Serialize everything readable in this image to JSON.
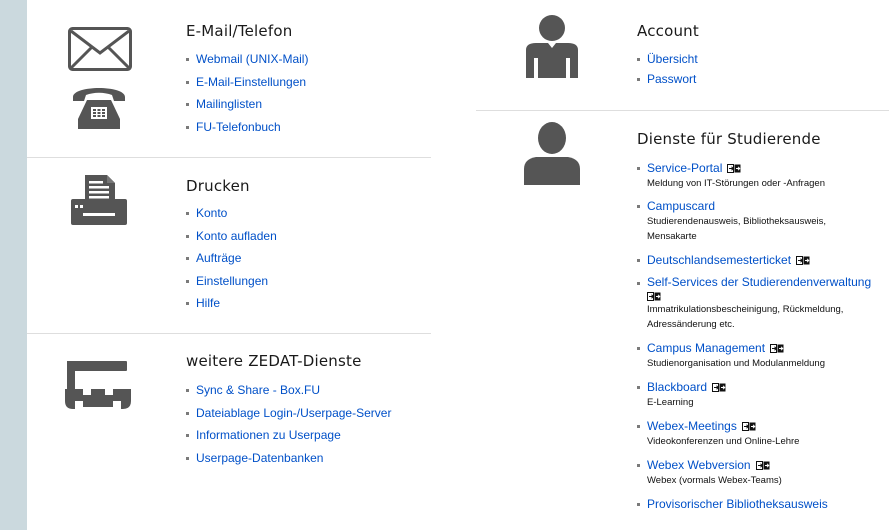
{
  "sections": {
    "email": {
      "title": "E-Mail/Telefon",
      "links": [
        "Webmail (UNIX-Mail)",
        "E-Mail-Einstellungen",
        "Mailinglisten",
        "FU-Telefonbuch"
      ],
      "icons": [
        "envelope-icon",
        "telephone-icon"
      ]
    },
    "print": {
      "title": "Drucken",
      "links": [
        "Konto",
        "Konto aufladen",
        "Aufträge",
        "Einstellungen",
        "Hilfe"
      ],
      "icons": [
        "printer-icon"
      ]
    },
    "more": {
      "title": "weitere ZEDAT-Dienste",
      "links": [
        "Sync & Share - Box.FU",
        "Dateiablage Login-/Userpage-Server",
        "Informationen zu Userpage",
        "Userpage-Datenbanken"
      ],
      "icons": [
        "tools-icon"
      ]
    },
    "account": {
      "title": "Account",
      "links": [
        "Übersicht",
        "Passwort"
      ],
      "icons": [
        "user-suit-icon"
      ]
    },
    "students": {
      "title": "Dienste für Studierende",
      "icons": [
        "student-icon"
      ],
      "items": [
        {
          "label": "Service-Portal",
          "external": true,
          "desc": [
            "Meldung von IT-Störungen oder -Anfragen"
          ]
        },
        {
          "label": "Campuscard",
          "external": false,
          "desc": [
            "Studierendenausweis, Bibliotheksausweis,",
            "Mensakarte"
          ]
        },
        {
          "label": "Deutschlandsemesterticket",
          "external": true,
          "desc": []
        },
        {
          "label": "Self-Services der Studierendenverwaltung",
          "external": true,
          "desc": [
            "Immatrikulationsbescheinigung, Rückmeldung,",
            "Adressänderung etc."
          ]
        },
        {
          "label": "Campus Management",
          "external": true,
          "desc": [
            "Studienorganisation und Modulanmeldung"
          ]
        },
        {
          "label": "Blackboard",
          "external": true,
          "desc": [
            "E-Learning"
          ]
        },
        {
          "label": "Webex-Meetings",
          "external": true,
          "desc": [
            "Videokonferenzen und Online-Lehre"
          ]
        },
        {
          "label": "Webex Webversion",
          "external": true,
          "desc": [
            "Webex (vormals Webex-Teams)"
          ]
        },
        {
          "label": "Provisorischer Bibliotheksausweis",
          "external": false,
          "desc": []
        }
      ]
    }
  },
  "colors": {
    "link": "#0050c8",
    "icon": "#555555",
    "background": "#cbd9de"
  }
}
